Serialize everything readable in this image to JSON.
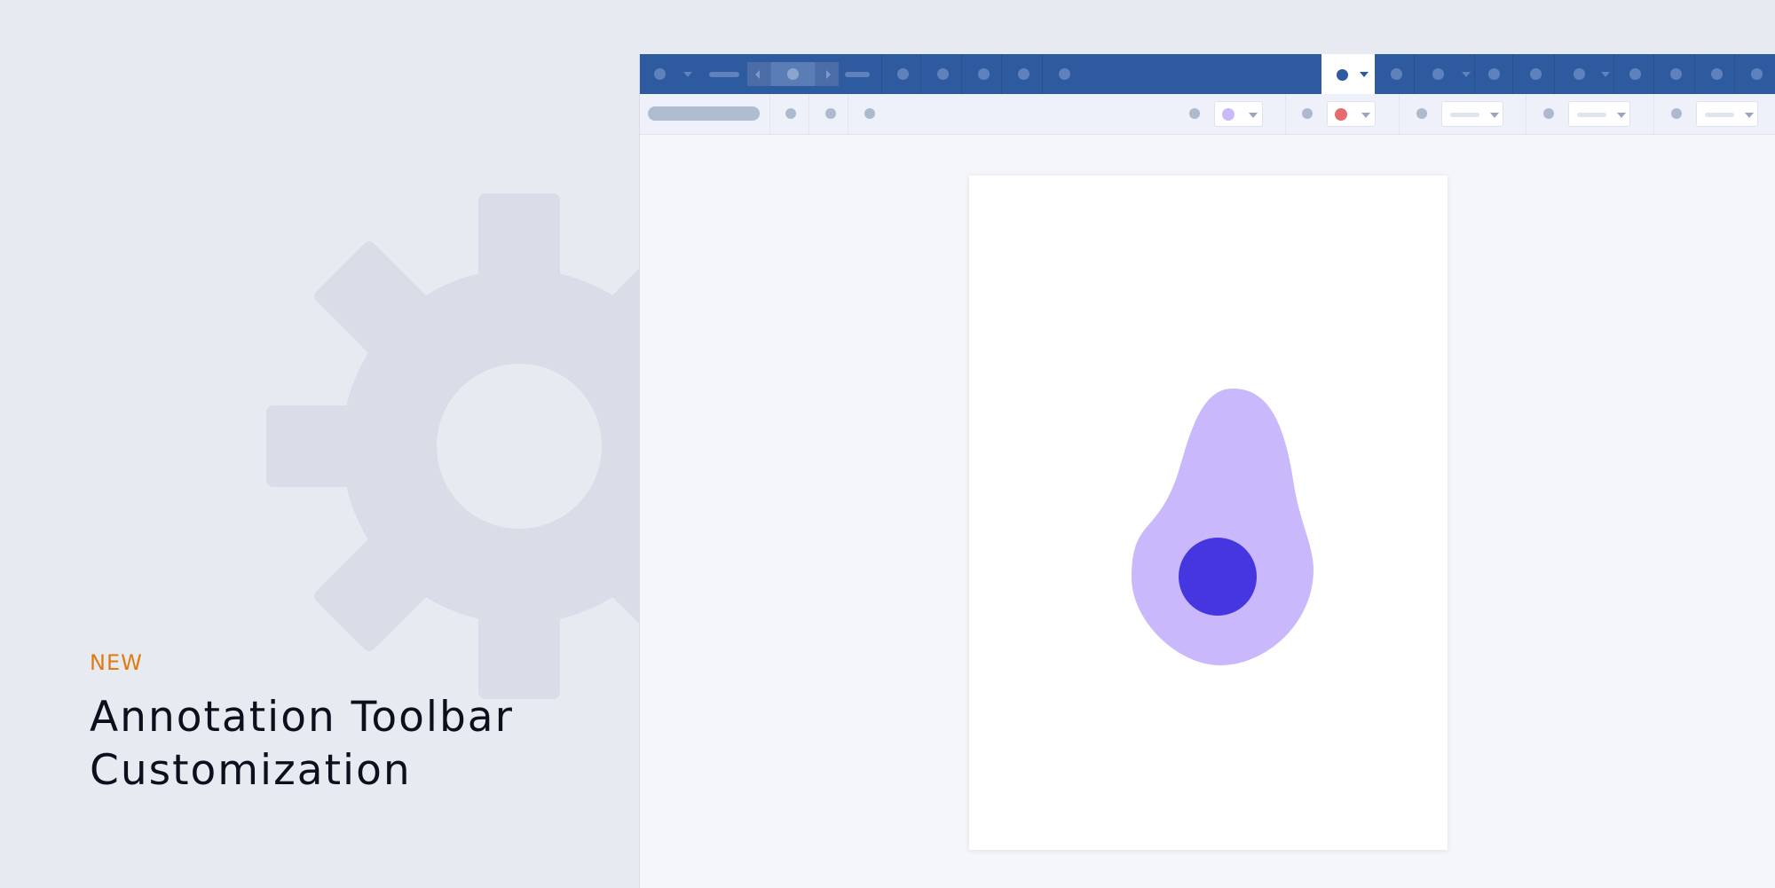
{
  "hero": {
    "tag": "NEW",
    "title_line1": "Annotation Toolbar",
    "title_line2": "Customization"
  },
  "colors": {
    "background": "#e7eaf1",
    "tag_accent": "#e07b0f",
    "toolbar_primary": "#2e5b9f",
    "toolbar_secondary": "#eef1fa",
    "fill_color_swatch": "#c9b8fb",
    "stroke_color_swatch": "#e56b6f",
    "shape_fill": "#c9b8fb",
    "shape_dot": "#4636e0"
  },
  "icons": {
    "background": "gear-icon",
    "document_shape": "avocado-shape"
  }
}
